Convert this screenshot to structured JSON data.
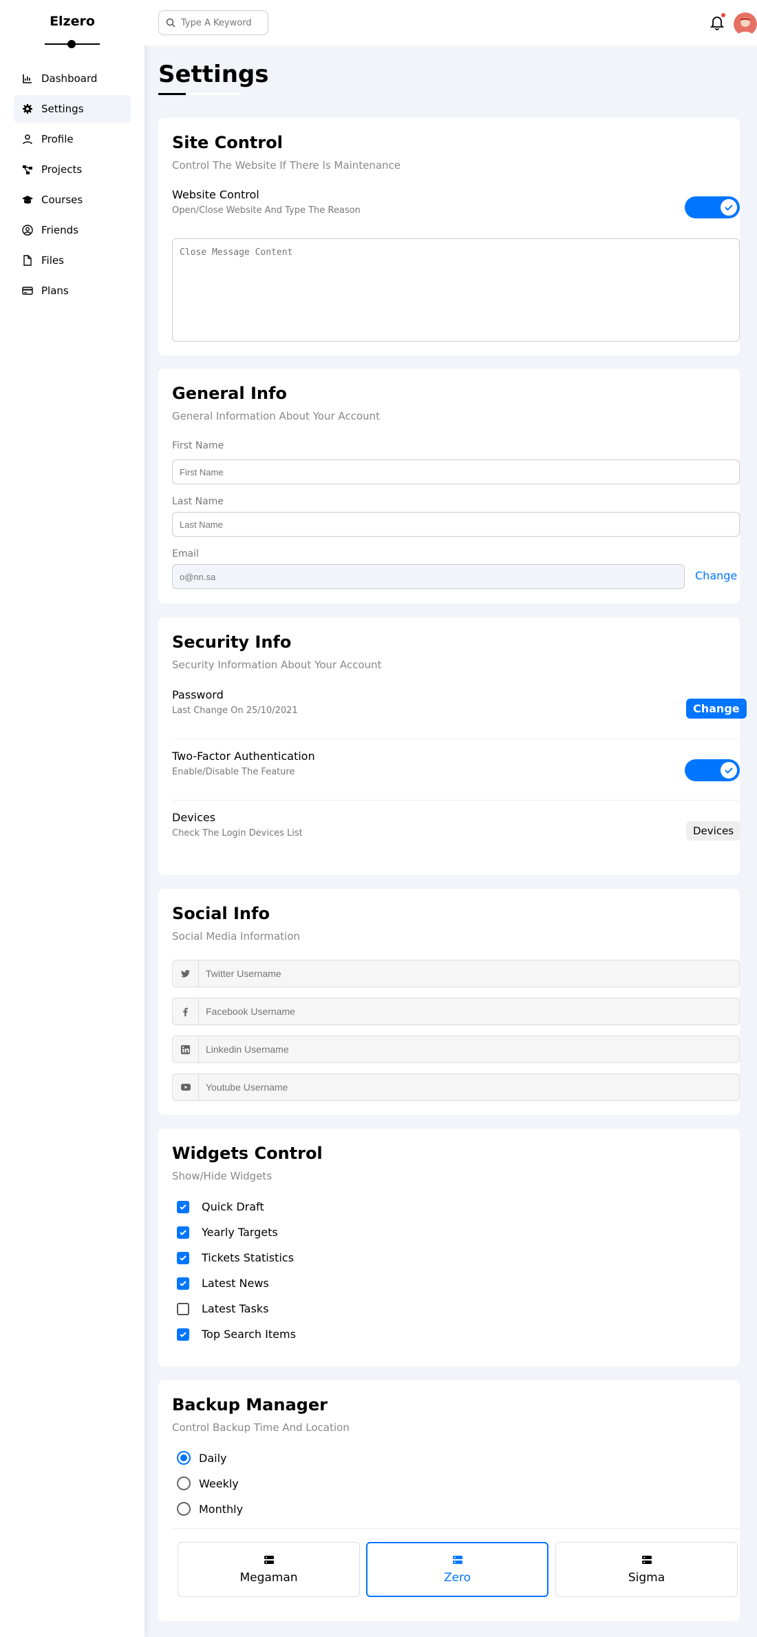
{
  "brand": "Elzero",
  "nav": [
    {
      "label": "Dashboard",
      "icon": "chart-icon"
    },
    {
      "label": "Settings",
      "icon": "gear-icon",
      "active": true
    },
    {
      "label": "Profile",
      "icon": "user-icon"
    },
    {
      "label": "Projects",
      "icon": "diagram-icon"
    },
    {
      "label": "Courses",
      "icon": "graduation-cap-icon"
    },
    {
      "label": "Friends",
      "icon": "user-circle-icon"
    },
    {
      "label": "Files",
      "icon": "file-icon"
    },
    {
      "label": "Plans",
      "icon": "credit-card-icon"
    }
  ],
  "search": {
    "placeholder": "Type A Keyword"
  },
  "page_title": "Settings",
  "site_control": {
    "title": "Site Control",
    "subtitle": "Control The Website If There Is Maintenance",
    "row_title": "Website Control",
    "row_desc": "Open/Close Website And Type The Reason",
    "toggle_on": true,
    "textarea_placeholder": "Close Message Content"
  },
  "general_info": {
    "title": "General Info",
    "subtitle": "General Information About Your Account",
    "first_name_label": "First Name",
    "first_name_placeholder": "First Name",
    "last_name_label": "Last Name",
    "last_name_placeholder": "Last Name",
    "email_label": "Email",
    "email_value": "o@nn.sa",
    "change_label": "Change"
  },
  "security_info": {
    "title": "Security Info",
    "subtitle": "Security Information About Your Account",
    "password_title": "Password",
    "password_desc": "Last Change On 25/10/2021",
    "password_button": "Change",
    "twofa_title": "Two-Factor Authentication",
    "twofa_desc": "Enable/Disable The Feature",
    "twofa_on": true,
    "devices_title": "Devices",
    "devices_desc": "Check The Login Devices List",
    "devices_button": "Devices"
  },
  "social_info": {
    "title": "Social Info",
    "subtitle": "Social Media Information",
    "fields": [
      {
        "icon": "twitter-icon",
        "placeholder": "Twitter Username"
      },
      {
        "icon": "facebook-icon",
        "placeholder": "Facebook Username"
      },
      {
        "icon": "linkedin-icon",
        "placeholder": "Linkedin Username"
      },
      {
        "icon": "youtube-icon",
        "placeholder": "Youtube Username"
      }
    ]
  },
  "widgets_control": {
    "title": "Widgets Control",
    "subtitle": "Show/Hide Widgets",
    "items": [
      {
        "label": "Quick Draft",
        "checked": true
      },
      {
        "label": "Yearly Targets",
        "checked": true
      },
      {
        "label": "Tickets Statistics",
        "checked": true
      },
      {
        "label": "Latest News",
        "checked": true
      },
      {
        "label": "Latest Tasks",
        "checked": false
      },
      {
        "label": "Top Search Items",
        "checked": true
      }
    ]
  },
  "backup_manager": {
    "title": "Backup Manager",
    "subtitle": "Control Backup Time And Location",
    "options": [
      {
        "label": "Daily",
        "selected": true
      },
      {
        "label": "Weekly",
        "selected": false
      },
      {
        "label": "Monthly",
        "selected": false
      }
    ],
    "servers": [
      {
        "label": "Megaman",
        "selected": false
      },
      {
        "label": "Zero",
        "selected": true
      },
      {
        "label": "Sigma",
        "selected": false
      }
    ]
  },
  "colors": {
    "accent": "#0075ff",
    "notification": "#f44336",
    "background": "#f1f5f9"
  }
}
